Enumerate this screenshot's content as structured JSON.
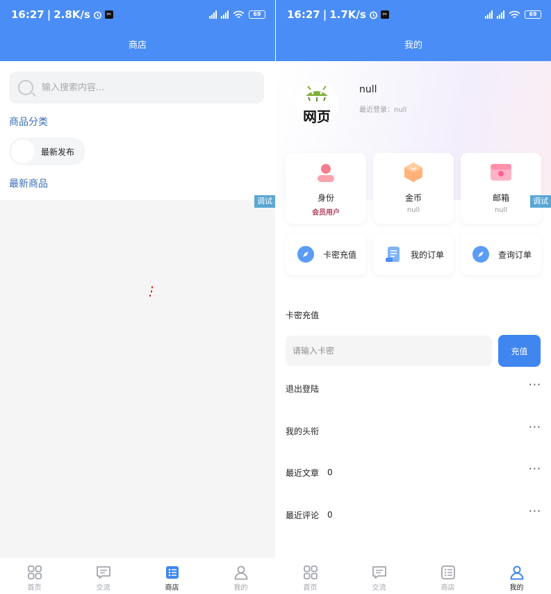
{
  "left": {
    "status": {
      "time": "16:27",
      "speed": "2.8K/s",
      "battery": "69"
    },
    "header_title": "商店",
    "search": {
      "placeholder": "输入搜索内容..."
    },
    "category_title": "商品分类",
    "category_chip": "最新发布",
    "latest_title": "最新商品",
    "debug": "调试"
  },
  "right": {
    "status": {
      "time": "16:27",
      "speed": "1.7K/s",
      "battery": "69"
    },
    "header_title": "我的",
    "profile": {
      "avatar_caption": "网页",
      "name": "null",
      "last_login": "最近登录：null"
    },
    "stats": [
      {
        "label": "身份",
        "value": "会员用户"
      },
      {
        "label": "金币",
        "value": "null"
      },
      {
        "label": "邮箱",
        "value": "null"
      }
    ],
    "actions": [
      {
        "label": "卡密充值"
      },
      {
        "label": "我的订单"
      },
      {
        "label": "查询订单"
      }
    ],
    "recharge": {
      "title": "卡密充值",
      "placeholder": "请输入卡密",
      "button": "充值"
    },
    "rows": [
      {
        "label": "退出登陆",
        "count": ""
      },
      {
        "label": "我的头衔",
        "count": ""
      },
      {
        "label": "最近文章",
        "count": "0"
      },
      {
        "label": "最近评论",
        "count": "0"
      }
    ],
    "debug": "调试"
  },
  "tabbar": {
    "items": [
      {
        "label": "首页"
      },
      {
        "label": "交流"
      },
      {
        "label": "商店"
      },
      {
        "label": "我的"
      }
    ]
  },
  "colors": {
    "accent": "#4a8df6",
    "button": "#3f86f0",
    "category_text": "#3b6fb5",
    "debug": "#5aa7d3"
  }
}
